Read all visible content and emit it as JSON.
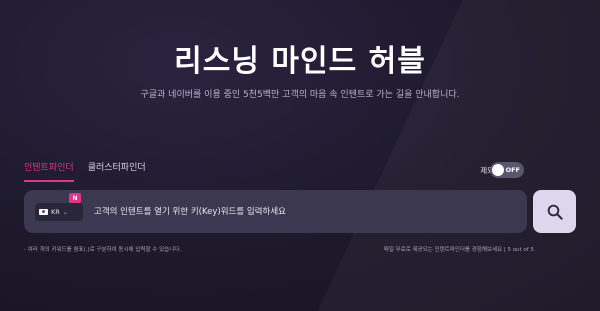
{
  "header": {
    "title": "리스닝 마인드 허블",
    "subtitle": "구글과 네이버를 이용 중인 5천5백만 고객의 마음 속 인텐트로 가는 길을 안내합니다."
  },
  "tabs": [
    {
      "label": "인텐트파인더",
      "active": true
    },
    {
      "label": "클러스터파인더",
      "active": false
    }
  ],
  "exclude": {
    "label": "제외단어 입력",
    "toggle_text": "OFF"
  },
  "search": {
    "country_code": "KR",
    "badge": "N",
    "placeholder": "고객의 인텐트를 열기 위한 키(Key)워드를 입력하세요",
    "value": ""
  },
  "hints": {
    "left": "- 여러 개의 키워드를 쉼표(,)로 구분하여 동시에 입력할 수 있습니다.",
    "right": "매일 무료로 제공되는 인텐트파인더를 경험해보세요 | 5 out of 5"
  },
  "colors": {
    "accent": "#e0348a",
    "background": "#1c1829",
    "searchbar": "#3d3852",
    "search_button": "#ddd7ee"
  },
  "icons": {
    "search": "search-icon",
    "flag": "kr-flag-icon",
    "chevron": "chevron-down-icon"
  }
}
